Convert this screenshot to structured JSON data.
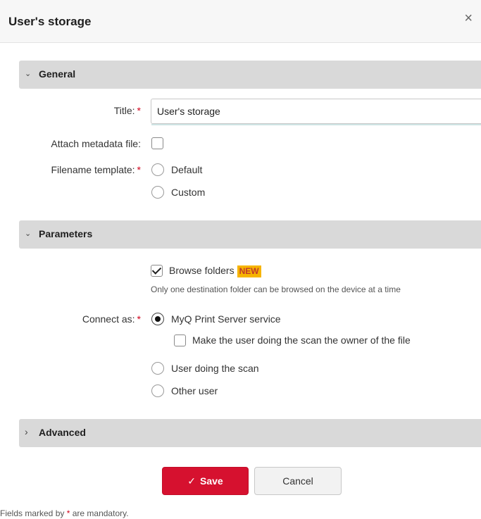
{
  "dialog": {
    "title": "User's storage",
    "close_glyph": "×",
    "close_icon": "close-icon"
  },
  "sections": {
    "general": {
      "label": "General",
      "expanded": true,
      "chevron": "⌄"
    },
    "parameters": {
      "label": "Parameters",
      "expanded": true,
      "chevron": "⌄"
    },
    "advanced": {
      "label": "Advanced",
      "expanded": false,
      "chevron": "›"
    }
  },
  "general": {
    "title_label": "Title:",
    "title_value": "User's storage",
    "attach_label": "Attach metadata file:",
    "attach_checked": false,
    "filename_label": "Filename template:",
    "filename_options": [
      "Default",
      "Custom"
    ],
    "filename_selected": null
  },
  "parameters": {
    "browse_label": "Browse folders",
    "browse_checked": true,
    "browse_badge": "NEW",
    "browse_hint": "Only one destination folder can be browsed on the device at a time",
    "connect_label": "Connect as:",
    "connect_options": [
      "MyQ Print Server service",
      "User doing the scan",
      "Other user"
    ],
    "connect_selected": "MyQ Print Server service",
    "owner_label": "Make the user doing the scan the owner of the file",
    "owner_checked": false
  },
  "required_marker": "*",
  "buttons": {
    "save_label": "Save",
    "save_icon": "✓",
    "cancel_label": "Cancel"
  },
  "footer": {
    "prefix": "Fields marked by",
    "marker": "*",
    "suffix": "are mandatory."
  },
  "colors": {
    "save_button": "#d6112f",
    "required": "#d0021b",
    "badge": "#f6b400",
    "section_header": "#d9d9d9"
  }
}
